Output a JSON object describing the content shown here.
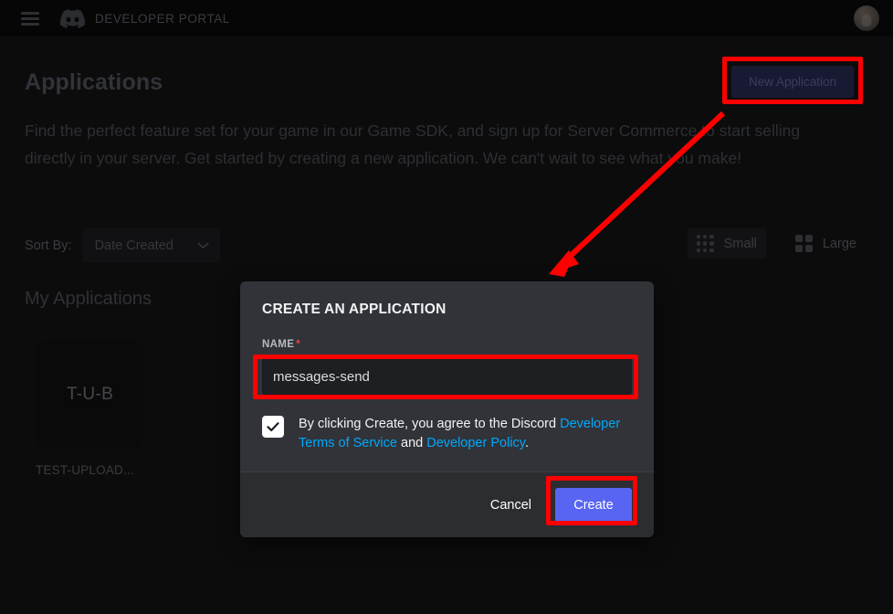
{
  "topbar": {
    "menu_icon": "hamburger-menu-icon",
    "logo_icon": "discord-logo-icon",
    "brand": "DEVELOPER PORTAL",
    "avatar_icon": "user-avatar"
  },
  "page": {
    "title": "Applications",
    "new_application_button": "New Application",
    "description": "Find the perfect feature set for your game in our Game SDK, and sign up for Server Commerce to start selling directly in your server. Get started by creating a new application. We can't wait to see what you make!"
  },
  "controls": {
    "sort_label": "Sort By:",
    "sort_value": "Date Created",
    "sort_chevron_icon": "chevron-down-icon",
    "view_small": "Small",
    "view_large": "Large",
    "small_icon": "dot-grid-icon",
    "large_icon": "square-grid-icon"
  },
  "applications": {
    "section_title": "My Applications",
    "items": [
      {
        "initials": "T-U-B",
        "name": "TEST-UPLOAD..."
      }
    ]
  },
  "modal": {
    "title": "CREATE AN APPLICATION",
    "name_label": "NAME",
    "required_marker": "*",
    "name_value": "messages-send",
    "name_placeholder": "",
    "checkbox_checked": true,
    "check_icon": "checkmark-icon",
    "terms_prefix": "By clicking Create, you agree to the Discord ",
    "terms_link_1": "Developer Terms of Service",
    "terms_conjunction": " and ",
    "terms_link_2": "Developer Policy",
    "terms_suffix": ".",
    "cancel_label": "Cancel",
    "create_label": "Create"
  },
  "annotations": {
    "highlight_color": "#ff0000",
    "arrow_icon": "arrow-pointer",
    "boxes": [
      "new-application-button",
      "name-input",
      "create-button"
    ]
  },
  "colors": {
    "background": "#0c0c0d",
    "topbar": "#060607",
    "modal": "#313338",
    "modal_footer": "#2b2d31",
    "blurple": "#5865f2",
    "link_blue": "#00a8fc",
    "required_red": "#f23f43",
    "annotation_red": "#ff0000"
  }
}
